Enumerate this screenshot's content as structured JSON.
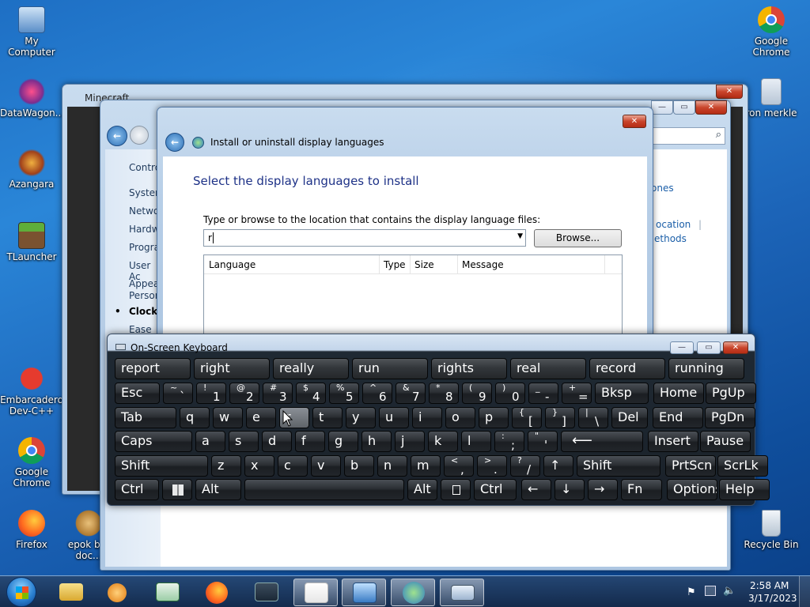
{
  "desktop": {
    "icons_left": [
      {
        "label": "My Computer"
      },
      {
        "label": "DataWagon..."
      },
      {
        "label": "Azangara"
      },
      {
        "label": "TLauncher"
      },
      {
        "label": "Embarcadero Dev-C++"
      },
      {
        "label": "Google Chrome"
      },
      {
        "label": "Firefox"
      },
      {
        "label": "epok b... doc..."
      }
    ],
    "icons_right": [
      {
        "label": "Google Chrome"
      },
      {
        "label": "ron merkle"
      },
      {
        "label": "Recycle Bin"
      }
    ]
  },
  "minecraft_window": {
    "title": "Minecraft"
  },
  "control_panel": {
    "items": [
      "Contro",
      "System",
      "Netwo",
      "Hardw",
      "Progra",
      "User Ac",
      "Appear",
      "Person",
      "Clock,",
      "Ease of"
    ],
    "right_links": [
      "ones",
      "ocation",
      "ethods"
    ],
    "search_icon": "search-icon"
  },
  "dialog": {
    "title": "Install or uninstall display languages",
    "heading": "Select the display languages to install",
    "path_label": "Type or browse to the location that contains the display language files:",
    "path_value": "r",
    "browse_label": "Browse...",
    "columns": [
      "Language",
      "Type",
      "Size",
      "Message"
    ]
  },
  "osk": {
    "title": "On-Screen Keyboard",
    "predictions": [
      "report",
      "right",
      "really",
      "run",
      "rights",
      "real",
      "record",
      "running"
    ],
    "row1": [
      {
        "top": "",
        "bottom": "Esc"
      },
      {
        "top": "~",
        "bottom": "`"
      },
      {
        "top": "!",
        "bottom": "1"
      },
      {
        "top": "@",
        "bottom": "2"
      },
      {
        "top": "#",
        "bottom": "3"
      },
      {
        "top": "$",
        "bottom": "4"
      },
      {
        "top": "%",
        "bottom": "5"
      },
      {
        "top": "^",
        "bottom": "6"
      },
      {
        "top": "&",
        "bottom": "7"
      },
      {
        "top": "*",
        "bottom": "8"
      },
      {
        "top": "(",
        "bottom": "9"
      },
      {
        "top": ")",
        "bottom": "0"
      },
      {
        "top": "_",
        "bottom": "-"
      },
      {
        "top": "+",
        "bottom": "="
      },
      {
        "top": "",
        "bottom": "Bksp"
      },
      {
        "top": "",
        "bottom": "Home"
      },
      {
        "top": "",
        "bottom": "PgUp"
      }
    ],
    "row2": [
      "Tab",
      "q",
      "w",
      "e",
      "r",
      "t",
      "y",
      "u",
      "i",
      "o",
      "p",
      "[",
      "]",
      "\\",
      "Del",
      "End",
      "PgDn"
    ],
    "row2_tops": [
      "",
      "",
      "",
      "",
      "",
      "",
      "",
      "",
      "",
      "",
      "",
      "{",
      "}",
      "|",
      "",
      "",
      ""
    ],
    "row3": [
      "Caps",
      "a",
      "s",
      "d",
      "f",
      "g",
      "h",
      "j",
      "k",
      "l",
      ";",
      "'",
      "",
      "Insert",
      "Pause"
    ],
    "row3_tops": [
      "",
      "",
      "",
      "",
      "",
      "",
      "",
      "",
      "",
      "",
      ":",
      "\"",
      "",
      "",
      ""
    ],
    "row4": [
      "Shift",
      "z",
      "x",
      "c",
      "v",
      "b",
      "n",
      "m",
      ",",
      ".",
      "/",
      "↑",
      "Shift",
      "PrtScn",
      "ScrLk"
    ],
    "row4_tops": [
      "",
      "",
      "",
      "",
      "",
      "",
      "",
      "",
      "<",
      ">",
      "?",
      "",
      "",
      "",
      ""
    ],
    "row5": [
      "Ctrl",
      "",
      "Alt",
      "",
      "Alt",
      "",
      "Ctrl",
      "←",
      "↓",
      "→",
      "Fn",
      "Options",
      "Help"
    ]
  },
  "taskbar": {
    "time": "2:58 AM",
    "date": "3/17/2023",
    "buttons": [
      "start-orb",
      "explorer",
      "media-player",
      "csharp",
      "firefox",
      "task-manager",
      "java",
      "control-panel",
      "region-language",
      "osk"
    ]
  }
}
